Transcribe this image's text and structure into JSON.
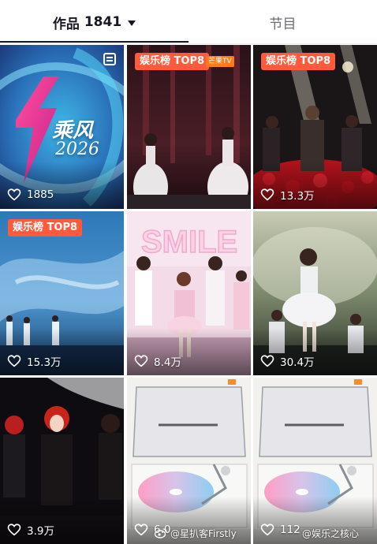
{
  "tabs": {
    "works_label": "作品",
    "works_count": "1841",
    "shows_label": "节目"
  },
  "grid": {
    "items": [
      {
        "title": "乘风",
        "year": "2026",
        "likes": "1885",
        "badge": ""
      },
      {
        "title": "",
        "likes": "",
        "badge": "娱乐榜 TOP8",
        "tv_logo": "芒果TV"
      },
      {
        "title": "",
        "likes": "13.3万",
        "badge": "娱乐榜 TOP8"
      },
      {
        "title": "",
        "likes": "15.3万",
        "badge": "娱乐榜 TOP8"
      },
      {
        "title": "",
        "likes": "8.4万",
        "badge": "",
        "stage_text": "SMILE"
      },
      {
        "title": "",
        "likes": "30.4万",
        "badge": ""
      },
      {
        "title": "",
        "likes": "3.9万",
        "badge": ""
      },
      {
        "title": "",
        "likes": "6.0",
        "badge": ""
      },
      {
        "title": "",
        "likes": "112",
        "badge": ""
      }
    ]
  },
  "watermarks": {
    "left": "@星扒客Firstly",
    "right": "@娱乐之核心"
  },
  "colors": {
    "accent": "#ff5a3c",
    "text_primary": "#161823",
    "text_secondary": "#6b6d75"
  }
}
